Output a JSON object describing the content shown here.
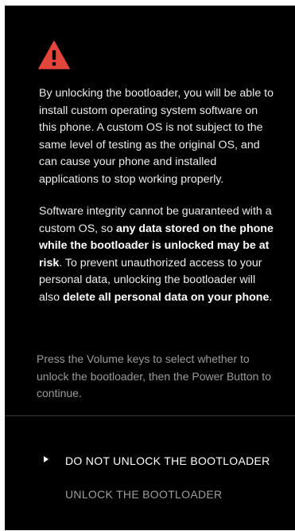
{
  "warning": {
    "icon": "warning-triangle-icon",
    "color": "#e2453a"
  },
  "paragraph1": {
    "text": "By unlocking the bootloader, you will be able to install custom operating system software on this phone. A custom OS is not subject to the same level of testing as the original OS, and can cause your phone and installed applications to stop working properly."
  },
  "paragraph2": {
    "part1": "Software integrity cannot be guaranteed with a custom OS, so ",
    "bold1": "any data stored on the phone while the bootloader is unlocked may be at risk",
    "part2": ". To prevent unauthorized access to your personal data, unlocking the bootloader will also ",
    "bold2": "delete all personal data on your phone",
    "part3": "."
  },
  "instructions": "Press the Volume keys to select whether to unlock the bootloader, then the Power Button to continue.",
  "options": [
    {
      "label": "DO NOT UNLOCK THE BOOTLOADER",
      "selected": true
    },
    {
      "label": "UNLOCK THE BOOTLOADER",
      "selected": false
    }
  ],
  "colors": {
    "background": "#000000",
    "text": "#ececec",
    "hint": "#9b9b9b",
    "selected_option": "#ffffff",
    "unselected_option": "#9e9e9e"
  }
}
